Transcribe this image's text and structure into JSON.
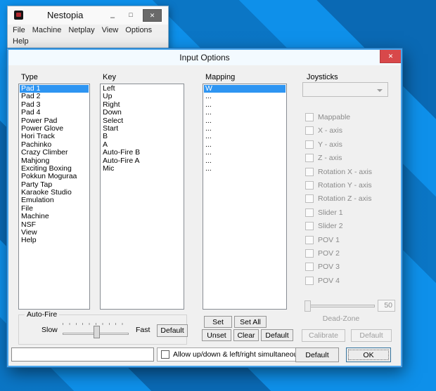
{
  "app_window": {
    "title": "Nestopia",
    "minimize_glyph": "–",
    "maximize_glyph": "□",
    "close_glyph": "✕",
    "menu_items": [
      "File",
      "Machine",
      "Netplay",
      "View",
      "Options",
      "Help"
    ]
  },
  "dialog": {
    "title": "Input Options",
    "close_glyph": "✕",
    "type_section": {
      "label": "Type",
      "selected_index": 0,
      "items": [
        "Pad 1",
        "Pad 2",
        "Pad 3",
        "Pad 4",
        "Power Pad",
        "Power Glove",
        "Hori Track",
        "Pachinko",
        "Crazy Climber",
        "Mahjong",
        "Exciting Boxing",
        "Pokkun Moguraa",
        "Party Tap",
        "Karaoke Studio",
        "Emulation",
        "File",
        "Machine",
        "NSF",
        "View",
        "Help"
      ]
    },
    "key_section": {
      "label": "Key",
      "items": [
        "Left",
        "Up",
        "Right",
        "Down",
        "Select",
        "Start",
        "B",
        "A",
        "Auto-Fire B",
        "Auto-Fire A",
        "Mic"
      ]
    },
    "mapping_section": {
      "label": "Mapping",
      "selected_index": 0,
      "items": [
        "W",
        "...",
        "...",
        "...",
        "...",
        "...",
        "...",
        "...",
        "...",
        "...",
        "..."
      ],
      "buttons": {
        "set": "Set",
        "set_all": "Set All",
        "unset": "Unset",
        "clear": "Clear",
        "default": "Default"
      }
    },
    "joysticks_section": {
      "label": "Joysticks",
      "dropdown_value": "",
      "checkboxes": [
        "Mappable",
        "X - axis",
        "Y - axis",
        "Z - axis",
        "Rotation X - axis",
        "Rotation Y - axis",
        "Rotation Z - axis",
        "Slider 1",
        "Slider 2",
        "POV 1",
        "POV 2",
        "POV 3",
        "POV 4"
      ],
      "dead_zone": {
        "label": "Dead-Zone",
        "value": "50"
      },
      "calibrate_label": "Calibrate",
      "default_label": "Default"
    },
    "auto_fire": {
      "label": "Auto-Fire",
      "slow_label": "Slow",
      "fast_label": "Fast",
      "default_label": "Default"
    },
    "bottom_bar": {
      "capture_value": "",
      "simultaneous_checkbox_label": "Allow up/down & left/right simultaneously",
      "default_label": "Default",
      "ok_label": "OK"
    }
  }
}
